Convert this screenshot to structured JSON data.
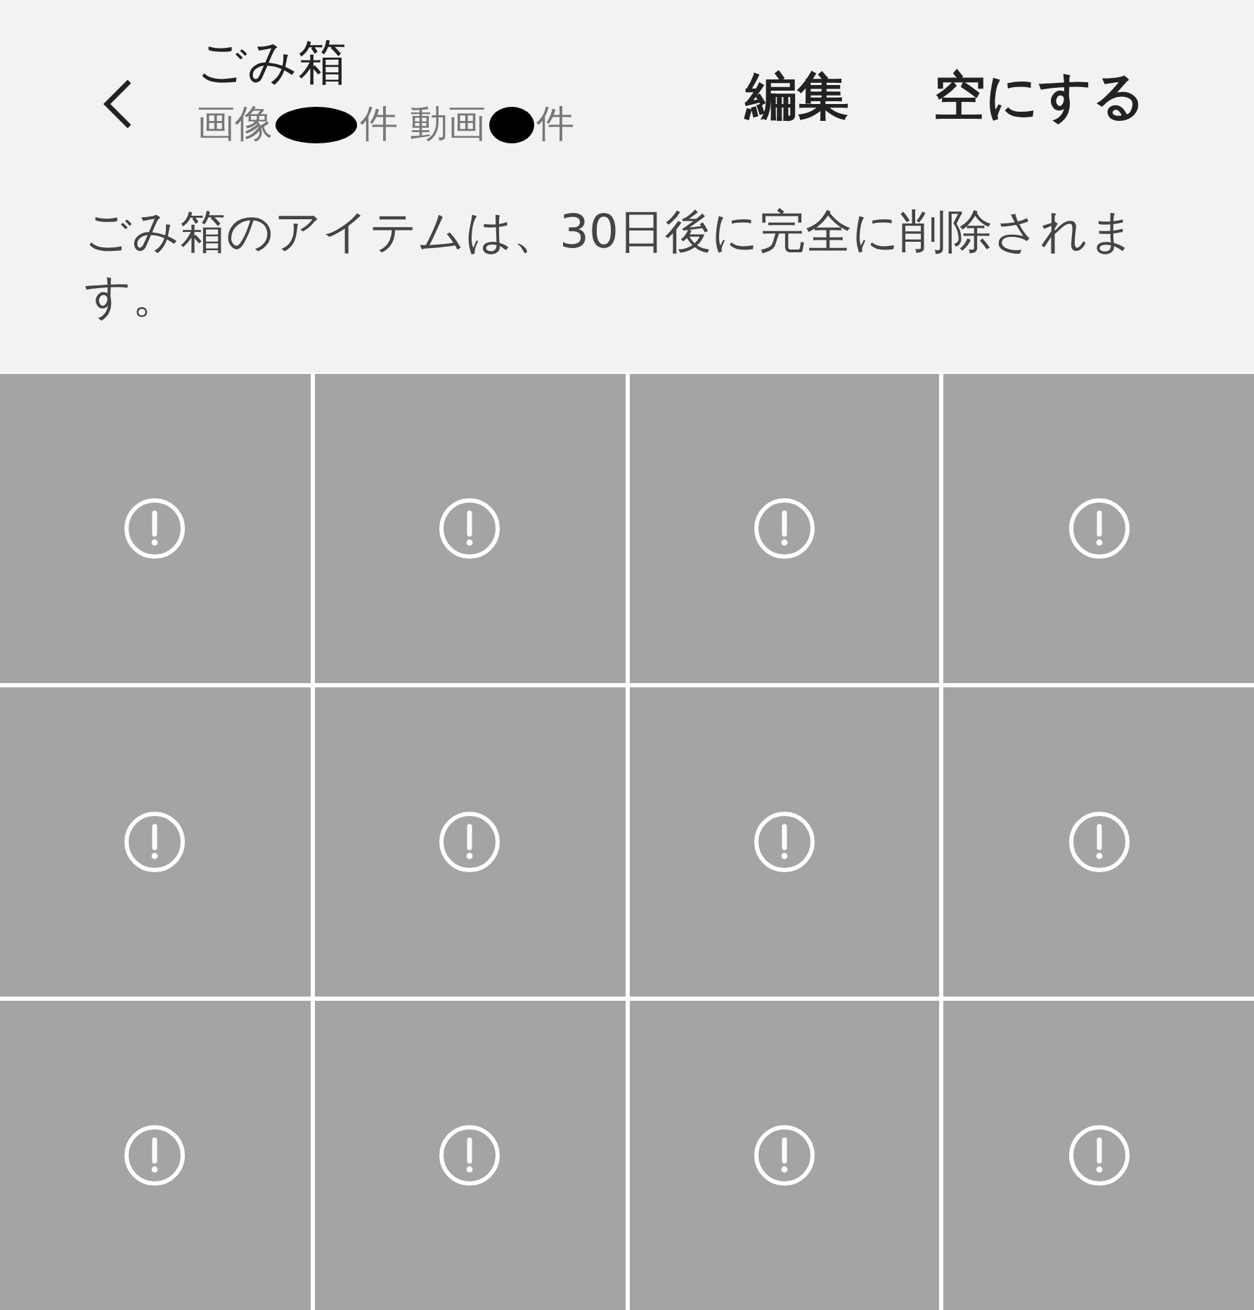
{
  "header": {
    "title": "ごみ箱",
    "subtitle_parts": [
      "画像",
      "件 動画",
      "件"
    ],
    "actions": [
      "編集",
      "空にする"
    ]
  },
  "notice": "ごみ箱のアイテムは、30日後に完全に削除されます。",
  "tiles": [
    {
      "kind": "unavailable"
    },
    {
      "kind": "unavailable"
    },
    {
      "kind": "unavailable"
    },
    {
      "kind": "unavailable"
    },
    {
      "kind": "unavailable"
    },
    {
      "kind": "unavailable"
    },
    {
      "kind": "unavailable"
    },
    {
      "kind": "unavailable"
    },
    {
      "kind": "unavailable"
    },
    {
      "kind": "unavailable"
    },
    {
      "kind": "unavailable"
    },
    {
      "kind": "unavailable"
    }
  ]
}
